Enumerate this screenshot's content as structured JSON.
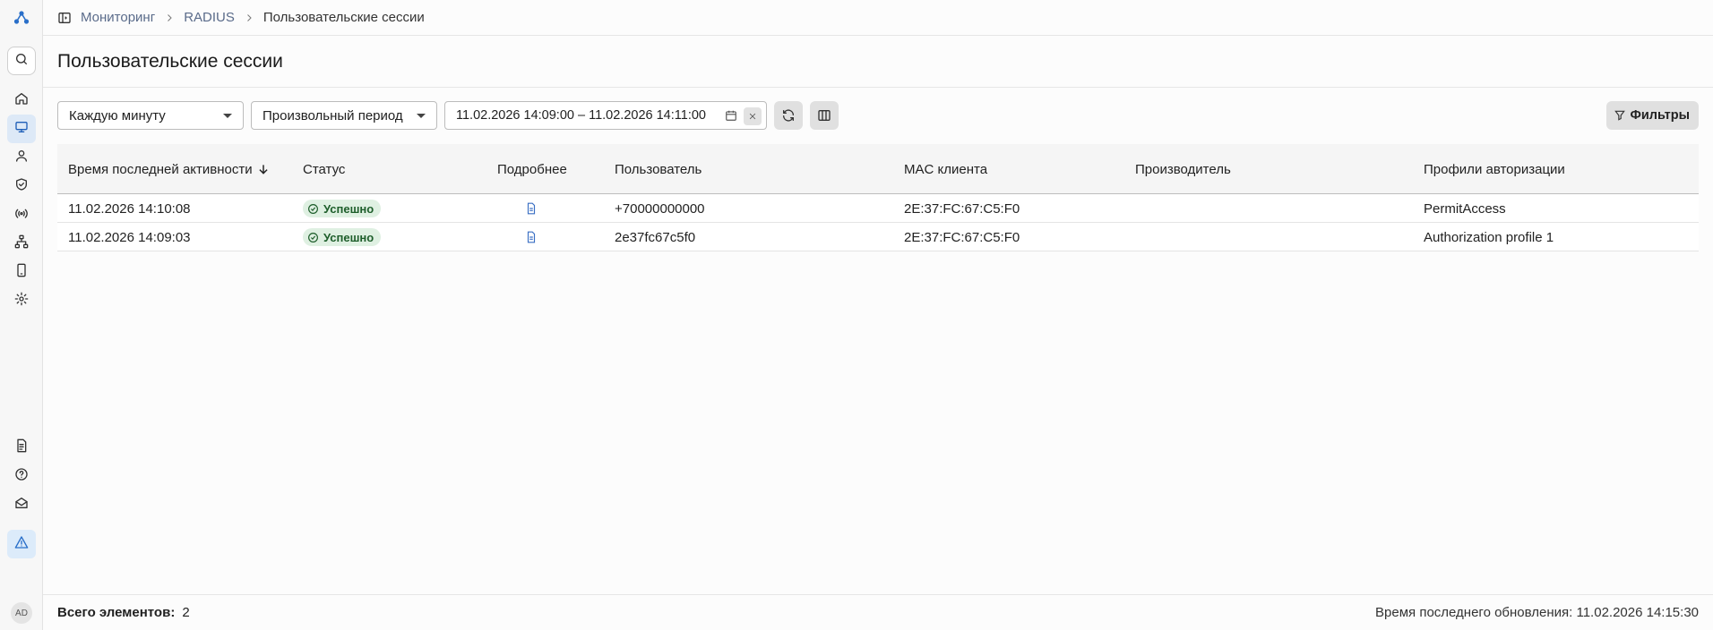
{
  "breadcrumb": {
    "items": [
      "Мониторинг",
      "RADIUS",
      "Пользовательские сессии"
    ]
  },
  "page": {
    "title": "Пользовательские сессии"
  },
  "toolbar": {
    "interval": "Каждую минуту",
    "period": "Произвольный период",
    "date_range": "11.02.2026 14:09:00 – 11.02.2026 14:11:00",
    "filters_label": "Фильтры"
  },
  "table": {
    "columns": [
      "Время последней активности",
      "Статус",
      "Подробнее",
      "Пользователь",
      "MAC клиента",
      "Производитель",
      "Профили авторизации"
    ],
    "sort_column": "Время последней активности",
    "rows": [
      {
        "time": "11.02.2026 14:10:08",
        "status": "Успешно",
        "user": "+70000000000",
        "mac": "2E:37:FC:67:C5:F0",
        "vendor": "",
        "profile": "PermitAccess"
      },
      {
        "time": "11.02.2026 14:09:03",
        "status": "Успешно",
        "user": "2e37fc67c5f0",
        "mac": "2E:37:FC:67:C5:F0",
        "vendor": "",
        "profile": "Authorization profile 1"
      }
    ]
  },
  "footer": {
    "total_label": "Всего элементов:",
    "total_value": "2",
    "updated": "Время последнего обновления: 11.02.2026 14:15:30"
  },
  "user": {
    "initials": "AD"
  },
  "icons": {
    "sidebar": [
      "search-icon",
      "home-icon",
      "monitor-icon",
      "user-icon",
      "shield-check-icon",
      "radio-signal-icon",
      "network-icon",
      "smartphone-icon",
      "settings-icon",
      "docs-icon",
      "help-icon",
      "mail-icon",
      "alert-icon"
    ]
  },
  "colors": {
    "accent": "#1f5fb8",
    "success_bg": "#dff0e2",
    "success_text": "#1e5e2b"
  }
}
